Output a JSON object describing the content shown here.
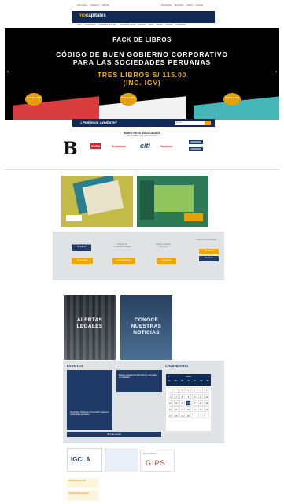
{
  "topbar": {
    "left": [
      "Informativo",
      "Contactos",
      "Noticias"
    ],
    "right": [
      "Suscripción",
      "Mis Libros",
      "Carrito",
      "Ingresar"
    ]
  },
  "header": {
    "logo_prefix": "ino",
    "logo_main": "capitales"
  },
  "nav": [
    "Inicio",
    "Publicaciones",
    "Sociedades de la BVL",
    "Mercado de Valores",
    "Eventos",
    "Libros",
    "Alertas",
    "Artículos",
    "Contáctenos"
  ],
  "banner": {
    "line1": "PACK DE LIBROS",
    "line2": "CÓDIGO DE BUEN GOBIERNO CORPORATIVO",
    "line3": "PARA LAS SOCIEDADES PERUANAS",
    "price1": "TRES LIBROS S/ 115.00",
    "price2": "(INC. IGV)",
    "badge": "S/ 49 (Inc. IGV)",
    "arrow_left": "‹",
    "arrow_right": "›",
    "colors": {
      "bg": "#000000",
      "price": "#f2b705",
      "badge": "#e8a000"
    }
  },
  "help": {
    "title": "¿Podemos ayudarte?",
    "placeholder": "Buscar"
  },
  "associates": {
    "title": "NUESTROS ASOCIADOS",
    "subtitle": "ENTIDADES QUE NOS APOYAN",
    "logos": [
      "B",
      "SURA",
      "Scotiabank",
      "citi",
      "Santander",
      "ASOCIADO",
      "ASOCIADO"
    ]
  },
  "services": {
    "cards": [
      "Información de Mercado de Valores",
      "Reportes de Sociedades Listadas",
      "Análisis y Estudios Financieros",
      "Suscripción Institucional"
    ],
    "buttons": [
      "Ver Servicios",
      "Ver Publicaciones",
      "Ver Estudios",
      "Ver Planes",
      "Suscríbete"
    ]
  },
  "tiles": {
    "alertas": "ALERTAS LEGALES",
    "noticias": "CONOCE NUESTRAS NOTICIAS"
  },
  "events": {
    "title": "EVENTOS",
    "cards": [
      {
        "title": "Seminario \"Gobierno Corporativo\" para las sociedades peruanas"
      },
      {
        "title": "Evento: Gobierno Corporativo y mercados de capitales"
      }
    ],
    "cta": "Ver más eventos"
  },
  "calendar": {
    "title": "CALENDARIO",
    "year": "2023",
    "days": [
      "Lu",
      "Ma",
      "Mi",
      "Ju",
      "Vi",
      "Sá",
      "Do"
    ],
    "dates": [
      "",
      "",
      "1",
      "2",
      "3",
      "4",
      "5",
      "6",
      "7",
      "8",
      "9",
      "10",
      "11",
      "12",
      "13",
      "14",
      "15",
      "16",
      "17",
      "18",
      "19",
      "20",
      "21",
      "22",
      "23",
      "24",
      "25",
      "26",
      "27",
      "28",
      "29",
      "30",
      "",
      "",
      ""
    ],
    "selected": "16"
  },
  "bottom": {
    "logo1": "IGCLA",
    "logo2_top": "Grupo Gobierno",
    "logo2": "GIPS",
    "download1": "DESCARGA LA APP",
    "download2": "VER EN GOOGLE PLAY"
  }
}
